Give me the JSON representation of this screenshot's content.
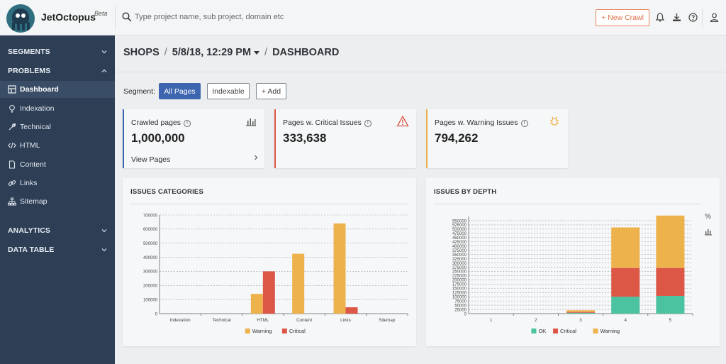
{
  "app": {
    "name": "JetOctopus",
    "beta": "Beta"
  },
  "search": {
    "placeholder": "Type project name, sub project, domain etc"
  },
  "header": {
    "new_crawl": "+ New Crawl"
  },
  "sidebar": {
    "sections": {
      "segments": "SEGMENTS",
      "problems": "PROBLEMS",
      "analytics": "ANALYTICS",
      "data_table": "DATA TABLE"
    },
    "items": [
      {
        "label": "Dashboard",
        "icon": "dashboard-icon",
        "active": true
      },
      {
        "label": "Indexation",
        "icon": "bulb-icon"
      },
      {
        "label": "Technical",
        "icon": "wrench-icon"
      },
      {
        "label": "HTML",
        "icon": "code-icon"
      },
      {
        "label": "Content",
        "icon": "document-icon"
      },
      {
        "label": "Links",
        "icon": "link-icon"
      },
      {
        "label": "Sitemap",
        "icon": "sitemap-icon"
      }
    ]
  },
  "breadcrumb": {
    "project": "SHOPS",
    "crawl": "5/8/18, 12:29 PM",
    "page": "DASHBOARD"
  },
  "segment": {
    "label": "Segment:",
    "options": [
      "All Pages",
      "Indexable",
      "+ Add"
    ],
    "active": "All Pages"
  },
  "stats": {
    "crawled": {
      "label": "Crawled pages",
      "value": "1,000,000",
      "link": "View Pages"
    },
    "critical": {
      "label": "Pages w. Critical Issues",
      "value": "333,638"
    },
    "warning": {
      "label": "Pages w. Warning Issues",
      "value": "794,262"
    }
  },
  "colors": {
    "warning": "#eeb24c",
    "critical": "#dc5746",
    "ok": "#4cc3a0",
    "accent": "#3e66b0",
    "sidebar": "#2d3e55"
  },
  "chart_data": [
    {
      "type": "bar",
      "title": "ISSUES CATEGORIES",
      "categories": [
        "Indexation",
        "Technical",
        "HTML",
        "Content",
        "Links",
        "Sitemap"
      ],
      "series": [
        {
          "name": "Warning",
          "values": [
            0,
            0,
            140000,
            425000,
            640000,
            0
          ]
        },
        {
          "name": "Critical",
          "values": [
            0,
            0,
            300000,
            0,
            45000,
            0
          ]
        }
      ],
      "ylim": [
        0,
        700000
      ],
      "yticks": [
        0,
        100000,
        200000,
        300000,
        400000,
        500000,
        600000,
        700000
      ],
      "grid": true,
      "legend": "bottom"
    },
    {
      "type": "bar",
      "stacked": true,
      "title": "ISSUES BY DEPTH",
      "categories": [
        "1",
        "2",
        "3",
        "4",
        "5"
      ],
      "series": [
        {
          "name": "OK",
          "values": [
            0,
            0,
            5000,
            100000,
            105000
          ]
        },
        {
          "name": "Critical",
          "values": [
            0,
            0,
            5000,
            170000,
            165000
          ]
        },
        {
          "name": "Warning",
          "values": [
            0,
            0,
            10000,
            240000,
            310000
          ]
        }
      ],
      "ylim": [
        0,
        575000
      ],
      "yticks": [
        0,
        25000,
        50000,
        75000,
        100000,
        125000,
        150000,
        175000,
        200000,
        225000,
        250000,
        275000,
        300000,
        325000,
        350000,
        375000,
        400000,
        425000,
        450000,
        475000,
        500000,
        525000,
        550000
      ],
      "grid": true,
      "legend": "bottom",
      "side_controls": [
        "%"
      ]
    }
  ]
}
